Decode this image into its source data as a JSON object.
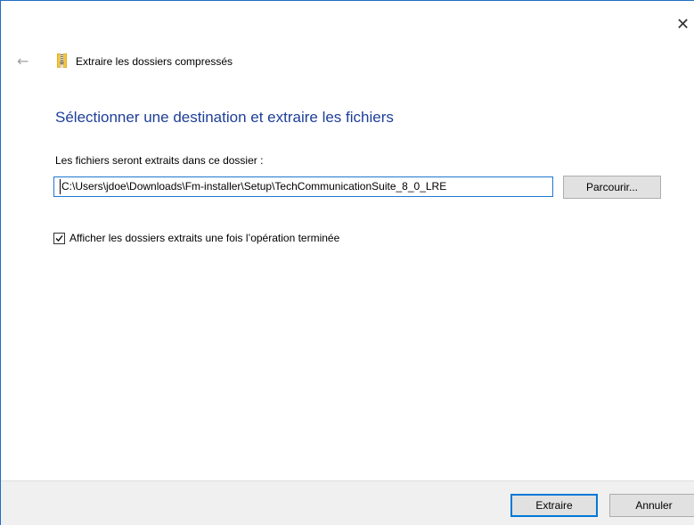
{
  "window": {
    "title": "Extraire les dossiers compressés",
    "close_glyph": "✕",
    "back_glyph": "←",
    "icon": "zip-folder-icon"
  },
  "main": {
    "heading": "Sélectionner une destination et extraire les fichiers",
    "destination_label": "Les fichiers seront extraits dans ce dossier :",
    "destination_path": "C:\\Users\\jdoe\\Downloads\\Fm-installer\\Setup\\TechCommunicationSuite_8_0_LRE",
    "browse_label": "Parcourir...",
    "show_files_checkbox": {
      "label": "Afficher les dossiers extraits une fois l’opération terminée",
      "checked": true
    }
  },
  "footer": {
    "extract_label": "Extraire",
    "cancel_label": "Annuler"
  },
  "colors": {
    "heading": "#1e3f9a",
    "accent_border": "#0078d7",
    "footer_bg": "#f0f0f0",
    "button_bg": "#e1e1e1"
  }
}
